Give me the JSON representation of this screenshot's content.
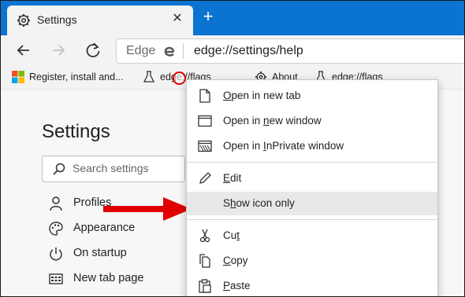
{
  "tab": {
    "title": "Settings",
    "close_glyph": "✕"
  },
  "newtab_glyph": "+",
  "address": {
    "brand": "Edge",
    "url": "edge://settings/help"
  },
  "favorites": [
    {
      "label": "Register, install and...",
      "icon": "microsoft-logo-icon"
    },
    {
      "label": "edge://flags",
      "icon": "flask-icon"
    },
    {
      "label": "About",
      "icon": "gear-icon"
    },
    {
      "label": "edge://flags",
      "icon": "flask-icon"
    }
  ],
  "settings": {
    "title": "Settings",
    "search_placeholder": "Search settings",
    "nav": [
      {
        "label": "Profiles",
        "icon": "person-icon"
      },
      {
        "label": "Appearance",
        "icon": "palette-icon"
      },
      {
        "label": "On startup",
        "icon": "power-icon"
      },
      {
        "label": "New tab page",
        "icon": "newtab-page-icon"
      }
    ]
  },
  "context_menu": {
    "items": [
      {
        "pre": "",
        "key": "O",
        "post": "pen in new tab",
        "icon": "page-icon"
      },
      {
        "pre": "Open in ",
        "key": "n",
        "post": "ew window",
        "icon": "window-icon"
      },
      {
        "pre": "Open in ",
        "key": "I",
        "post": "nPrivate window",
        "icon": "inprivate-icon"
      },
      {
        "pre": "",
        "key": "E",
        "post": "dit",
        "icon": "pencil-icon"
      },
      {
        "pre": "S",
        "key": "h",
        "post": "ow icon only",
        "icon": ""
      },
      {
        "pre": "Cu",
        "key": "t",
        "post": "",
        "icon": "scissors-icon"
      },
      {
        "pre": "",
        "key": "C",
        "post": "opy",
        "icon": "copy-icon"
      },
      {
        "pre": "",
        "key": "P",
        "post": "aste",
        "icon": "paste-icon"
      }
    ]
  },
  "colors": {
    "titlebar": "#0b74d1",
    "annotation": "#e00000"
  }
}
